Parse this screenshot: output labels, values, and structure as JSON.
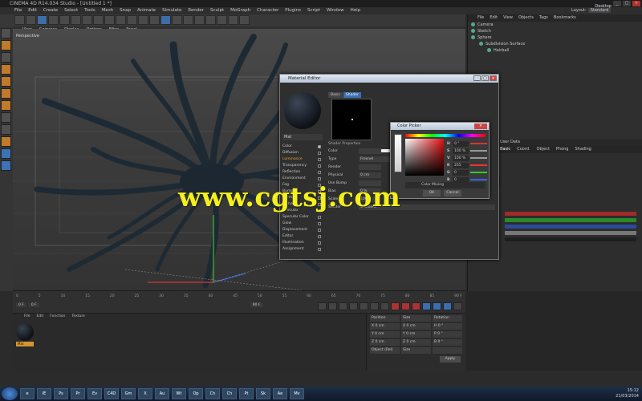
{
  "window": {
    "title": "CINEMA 4D R14.034 Studio - [Untitled 1 *]"
  },
  "menubar": [
    "File",
    "Edit",
    "Create",
    "Select",
    "Tools",
    "Mesh",
    "Snap",
    "Animate",
    "Simulate",
    "Render",
    "Sculpt",
    "MoGraph",
    "Character",
    "Plugins",
    "Script",
    "Window",
    "Help"
  ],
  "layout_label": "Layout:",
  "layout_value": "Standard",
  "viewport": {
    "menu": [
      "View",
      "Cameras",
      "Display",
      "Options",
      "Filter",
      "Panel"
    ],
    "label": "Perspective"
  },
  "object_manager": {
    "menu": [
      "File",
      "Edit",
      "View",
      "Objects",
      "Tags",
      "Bookmarks"
    ],
    "objects": [
      "Camera",
      "Sketch",
      "Sphere",
      "Subdivision Surface",
      "Hairball"
    ]
  },
  "attribute_manager": {
    "tabs": [
      "Basic",
      "Coord.",
      "Object",
      "Phong",
      "Shading"
    ],
    "active_tab": "Basic",
    "title": "User Data"
  },
  "timeline": {
    "ticks": [
      "0",
      "5",
      "10",
      "15",
      "20",
      "25",
      "30",
      "35",
      "40",
      "45",
      "50",
      "55",
      "60",
      "65",
      "70",
      "75",
      "80",
      "85",
      "90 F"
    ],
    "start": "0 F",
    "current": "0 F",
    "end": "90 F"
  },
  "material_manager": {
    "menu": [
      "File",
      "Edit",
      "Function",
      "Texture"
    ],
    "material_name": "Mat"
  },
  "coordinates": {
    "rows": [
      [
        "Position",
        "Size",
        "Rotation"
      ],
      [
        "X  0 cm",
        "X  0 cm",
        "H  0 °"
      ],
      [
        "Y  0 cm",
        "Y  0 cm",
        "P  0 °"
      ],
      [
        "Z  0 cm",
        "Z  0 cm",
        "B  0 °"
      ],
      [
        "Object (Rel)",
        "Size",
        ""
      ]
    ],
    "apply": "Apply"
  },
  "material_editor": {
    "title": "Material Editor",
    "material_name": "Mat",
    "channels": [
      {
        "name": "Color",
        "checked": true
      },
      {
        "name": "Diffusion",
        "checked": false
      },
      {
        "name": "Luminance",
        "checked": false,
        "active": true
      },
      {
        "name": "Transparency",
        "checked": false
      },
      {
        "name": "Reflection",
        "checked": false
      },
      {
        "name": "Environment",
        "checked": false
      },
      {
        "name": "Fog",
        "checked": false
      },
      {
        "name": "Bump",
        "checked": false
      },
      {
        "name": "Normal",
        "checked": false
      },
      {
        "name": "Alpha",
        "checked": false
      },
      {
        "name": "Specular",
        "checked": true
      },
      {
        "name": "Specular Color",
        "checked": false
      },
      {
        "name": "Glow",
        "checked": false
      },
      {
        "name": "Displacement",
        "checked": false
      },
      {
        "name": "Editor",
        "checked": false
      },
      {
        "name": "Illumination",
        "checked": false
      },
      {
        "name": "Assignment",
        "checked": false
      }
    ],
    "tabs": [
      "Basic",
      "Shader"
    ],
    "active_tab": "Shader",
    "section": "Shader Properties",
    "rows": [
      {
        "label": "Color",
        "value": ""
      },
      {
        "label": "Type",
        "value": "Fresnel"
      },
      {
        "label": "Render",
        "value": ""
      },
      {
        "label": "Physical",
        "value": "0 cm"
      },
      {
        "label": "Use Bump",
        "value": ""
      },
      {
        "label": "Bias",
        "value": "0 %"
      },
      {
        "label": "Scale",
        "value": "100 %"
      },
      {
        "label": "Shader",
        "value": "Gradient"
      }
    ]
  },
  "color_picker": {
    "title": "Color Picker",
    "close": "×",
    "values": [
      {
        "label": "H",
        "value": "0 °",
        "color": "#d33"
      },
      {
        "label": "S",
        "value": "100 %",
        "color": "#999"
      },
      {
        "label": "V",
        "value": "100 %",
        "color": "#999"
      },
      {
        "label": "R",
        "value": "255",
        "color": "#e33"
      },
      {
        "label": "G",
        "value": "0",
        "color": "#3c3"
      },
      {
        "label": "B",
        "value": "0",
        "color": "#36e"
      }
    ],
    "color_field": "Color Mixing",
    "ok": "OK",
    "cancel": "Cancel"
  },
  "watermark": "www.cgtsj.com",
  "taskbar": {
    "apps": [
      "e",
      "IE",
      "Ps",
      "Pr",
      "Ev",
      "C4D",
      "Gm",
      "X",
      "Au",
      "Wt",
      "Op",
      "Ch",
      "Ch",
      "Pt",
      "Sk",
      "Ae",
      "Mv"
    ],
    "tray": "Desktop",
    "time": "15:12",
    "date": "21/03/2014"
  },
  "colors": {
    "accent": "#3c6fb0",
    "active_channel": "#e6a036",
    "watermark": "#f4f01a",
    "material_label": "#d59630"
  }
}
